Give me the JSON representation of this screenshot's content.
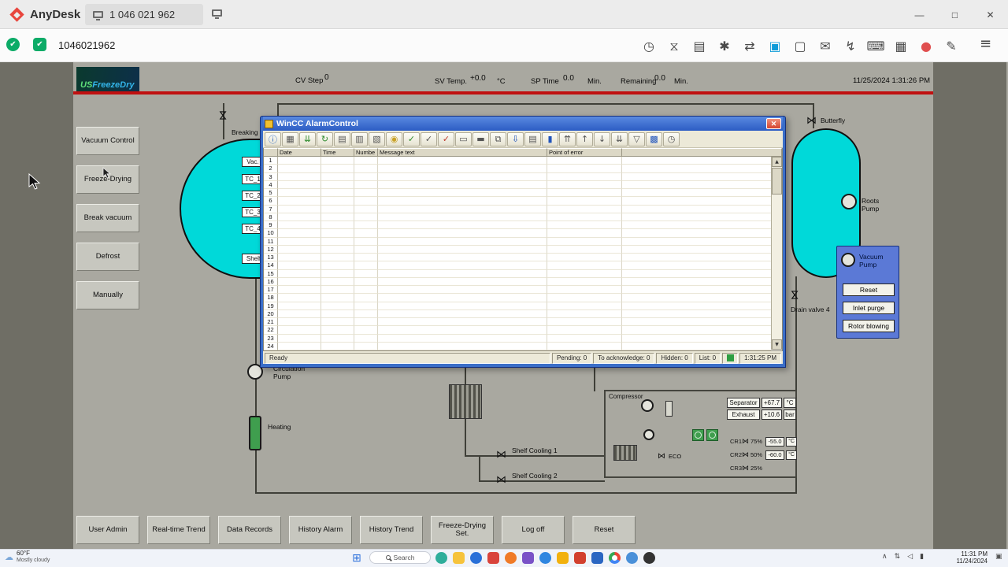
{
  "anydesk": {
    "app_name": "AnyDesk",
    "address_tab": "1 046 021 962",
    "session_id": "1046021962",
    "menu_icon": "≡",
    "window_controls": {
      "minimize": "—",
      "maximize": "□",
      "close": "✕"
    },
    "status_icons": [
      {
        "name": "connection-status-icon",
        "glyph": "✔",
        "color": "#0cab67",
        "shape": "circle"
      },
      {
        "name": "permissions-status-icon",
        "glyph": "✔",
        "color": "#0cab67",
        "shape": "rounded"
      }
    ],
    "toolbar_icons": [
      {
        "name": "speed-mode-icon",
        "glyph": "◷"
      },
      {
        "name": "session-duration-icon",
        "glyph": "⧖"
      },
      {
        "name": "vm-list-icon",
        "glyph": "▤"
      },
      {
        "name": "favorites-icon",
        "glyph": "✱"
      },
      {
        "name": "file-transfer-icon",
        "glyph": "⇄"
      },
      {
        "name": "active-monitor-icon",
        "glyph": "▣",
        "color": "#0e9bd8"
      },
      {
        "name": "display-settings-icon",
        "glyph": "▢"
      },
      {
        "name": "chat-icon",
        "glyph": "✉"
      },
      {
        "name": "actions-icon",
        "glyph": "↯"
      },
      {
        "name": "keyboard-settings-icon",
        "glyph": "⌨"
      },
      {
        "name": "permissions-icon",
        "glyph": "▦"
      },
      {
        "name": "record-session-icon",
        "glyph": "●",
        "color": "#e04f4f"
      },
      {
        "name": "whiteboard-icon",
        "glyph": "✎"
      }
    ]
  },
  "scada": {
    "logo": {
      "infinity": "∞",
      "us": "US",
      "rest": "FreezeDry"
    },
    "header": {
      "cv_step_label": "CV Step",
      "cv_step_value": "0",
      "sv_temp_label": "SV Temp.",
      "sv_temp_value": "+0.0",
      "sv_temp_unit": "°C",
      "sp_time_label": "SP Time",
      "sp_time_value": "0.0",
      "sp_time_unit": "Min.",
      "remaining_label": "Remaining",
      "remaining_value": "0.0",
      "remaining_unit": "Min.",
      "datetime": "11/25/2024 1:31:26 PM"
    },
    "icons": {
      "valve": "⋈"
    },
    "nav_buttons": [
      "Vacuum Control",
      "Freeze-Drying",
      "Break vacuum",
      "Defrost",
      "Manually"
    ],
    "tank_sensor_labels": [
      "Vac.",
      "TC_1",
      "TC_2",
      "TC_3",
      "TC_4",
      "Shelf"
    ],
    "labels": {
      "breaking": "Breaking",
      "butterfly": "Butterfly",
      "roots_pump": "Roots Pump",
      "vacuum_pump": "Vacuum Pump",
      "drain_valve": "Drain valve 4",
      "circulation_pump": "Circulation Pump",
      "heating": "Heating",
      "shelf_cooling_1": "Shelf Cooling 1",
      "shelf_cooling_2": "Shelf Cooling 2",
      "compressor": "Compressor",
      "eco": "ECO"
    },
    "vacuum_pump_buttons": [
      "Reset",
      "Inlet purge",
      "Rotor blowing"
    ],
    "compressor": {
      "separator_label": "Separator",
      "separator_value": "+67.7",
      "separator_unit": "°C",
      "exhaust_label": "Exhaust",
      "exhaust_value": "+10.6",
      "exhaust_unit": "bar",
      "cr_rows": [
        {
          "label": "CR1",
          "pct": "75%",
          "value": "-55.0",
          "unit": "°C"
        },
        {
          "label": "CR2",
          "pct": "50%",
          "value": "-60.0",
          "unit": "°C"
        },
        {
          "label": "CR3",
          "pct": "25%",
          "value": "",
          "unit": ""
        }
      ]
    },
    "bottom_buttons": [
      "User Admin",
      "Real-time Trend",
      "Data Records",
      "History Alarm",
      "History Trend",
      "Freeze-Drying Set.",
      "Log off",
      "Reset"
    ]
  },
  "alarm_window": {
    "title": "WinCC AlarmControl",
    "close_glyph": "✕",
    "scroll_up_glyph": "▲",
    "scroll_down_glyph": "▼",
    "toolbar_icons": [
      {
        "name": "help-info-icon",
        "glyph": "ⓘ",
        "color": "#1f5fbf"
      },
      {
        "name": "configuration-icon",
        "glyph": "▦",
        "color": "#555555"
      },
      {
        "name": "autoscroll-icon",
        "glyph": "⇊",
        "color": "#2e8b2e"
      },
      {
        "name": "refresh-icon",
        "glyph": "↻",
        "color": "#2e8b2e"
      },
      {
        "name": "message-list-icon",
        "glyph": "▤",
        "color": "#555555"
      },
      {
        "name": "short-term-list-icon",
        "glyph": "▥",
        "color": "#555555"
      },
      {
        "name": "long-term-list-icon",
        "glyph": "▧",
        "color": "#555555"
      },
      {
        "name": "lock-list-icon",
        "glyph": "◉",
        "color": "#c9a227"
      },
      {
        "name": "acknowledge-icon",
        "glyph": "✓",
        "color": "#2e8b2e"
      },
      {
        "name": "group-acknowledge-icon",
        "glyph": "✓",
        "color": "#555555"
      },
      {
        "name": "emergency-acknowledge-icon",
        "glyph": "✓",
        "color": "#c0392b"
      },
      {
        "name": "hide-message-icon",
        "glyph": "▭",
        "color": "#555555"
      },
      {
        "name": "unhide-message-icon",
        "glyph": "▬",
        "color": "#555555"
      },
      {
        "name": "copy-icon",
        "glyph": "⧉",
        "color": "#555555"
      },
      {
        "name": "export-icon",
        "glyph": "⇩",
        "color": "#2255bb"
      },
      {
        "name": "print-icon",
        "glyph": "▤",
        "color": "#555555"
      },
      {
        "name": "comment-icon",
        "glyph": "▮",
        "color": "#2255bb"
      },
      {
        "name": "first-message-icon",
        "glyph": "⇈",
        "color": "#555555"
      },
      {
        "name": "previous-message-icon",
        "glyph": "↑",
        "color": "#555555"
      },
      {
        "name": "next-message-icon",
        "glyph": "↓",
        "color": "#555555"
      },
      {
        "name": "last-message-icon",
        "glyph": "⇊",
        "color": "#555555"
      },
      {
        "name": "filter-icon",
        "glyph": "▽",
        "color": "#555555"
      },
      {
        "name": "selection-icon",
        "glyph": "▩",
        "color": "#2255bb"
      },
      {
        "name": "time-base-icon",
        "glyph": "◷",
        "color": "#555555"
      }
    ],
    "columns": [
      "",
      "Date",
      "Time",
      "Numbe",
      "Message text",
      "Point of error"
    ],
    "rows": [
      "1",
      "2",
      "3",
      "4",
      "5",
      "6",
      "7",
      "8",
      "9",
      "10",
      "11",
      "12",
      "13",
      "14",
      "15",
      "16",
      "17",
      "18",
      "19",
      "20",
      "21",
      "22",
      "23",
      "24"
    ],
    "status_ready": "Ready",
    "status_items": [
      "Pending: 0",
      "To acknowledge: 0",
      "Hidden: 0",
      "List: 0"
    ],
    "status_time": "1:31:25 PM"
  },
  "taskbar": {
    "weather_icon": "☁",
    "weather_temp": "60°F",
    "weather_desc": "Mostly cloudy",
    "start_glyph": "⊞",
    "search_label": "Search",
    "app_icons": [
      {
        "name": "taskbar-app-1-icon",
        "color": "#2fae9b",
        "shape": "circle"
      },
      {
        "name": "taskbar-folder-icon",
        "color": "#f6c33c",
        "shape": "rounded"
      },
      {
        "name": "taskbar-app-2-icon",
        "color": "#2a70d8",
        "shape": "circle"
      },
      {
        "name": "taskbar-app-3-icon",
        "color": "#d9443c",
        "shape": "rounded"
      },
      {
        "name": "taskbar-firefox-icon",
        "color": "#f07b28",
        "shape": "circle"
      },
      {
        "name": "taskbar-app-4-icon",
        "color": "#7a52c7",
        "shape": "rounded"
      },
      {
        "name": "taskbar-app-5-icon",
        "color": "#2f86e0",
        "shape": "circle"
      },
      {
        "name": "taskbar-app-6-icon",
        "color": "#f2b10e",
        "shape": "rounded"
      },
      {
        "name": "taskbar-app-7-icon",
        "color": "#d2402e",
        "shape": "rounded"
      },
      {
        "name": "taskbar-app-8-icon",
        "color": "#2b66c2",
        "shape": "rounded"
      },
      {
        "name": "taskbar-chrome-icon",
        "shape": "chrome"
      },
      {
        "name": "taskbar-app-9-icon",
        "color": "#4a90d9",
        "shape": "circle"
      },
      {
        "name": "taskbar-app-10-icon",
        "color": "#333333",
        "shape": "circle"
      }
    ],
    "tray_icons": [
      {
        "name": "tray-chevron-icon",
        "glyph": "∧"
      },
      {
        "name": "tray-network-icon",
        "glyph": "⇅"
      },
      {
        "name": "tray-volume-icon",
        "glyph": "◁"
      },
      {
        "name": "tray-battery-icon",
        "glyph": "▮"
      }
    ],
    "time": "11:31 PM",
    "date": "11/24/2024",
    "notification_glyph": "▣"
  }
}
